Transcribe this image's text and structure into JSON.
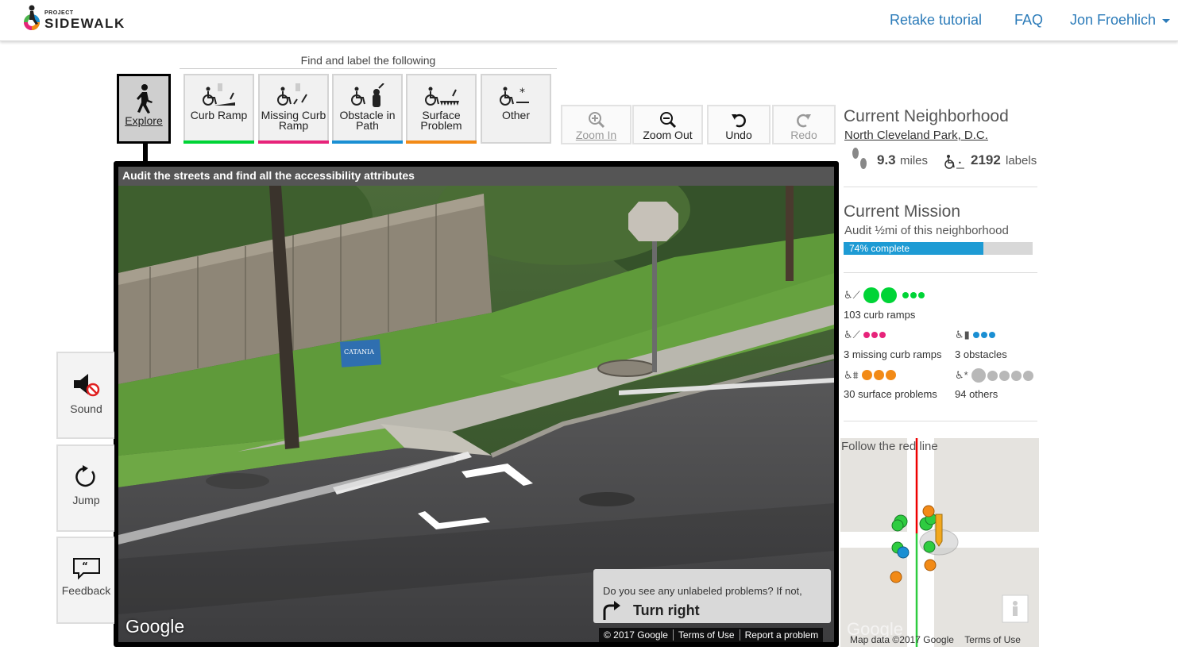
{
  "header": {
    "logo_small": "PROJECT",
    "logo_big": "SIDEWALK",
    "nav": [
      {
        "label": "Retake tutorial"
      },
      {
        "label": "FAQ"
      },
      {
        "label": "Jon Froehlich"
      }
    ]
  },
  "toolbar": {
    "title": "Find and label the following",
    "explore_label": "Explore",
    "modes": [
      {
        "label": "Curb Ramp",
        "color": "#00d436"
      },
      {
        "label": "Missing Curb Ramp",
        "color": "#e7237a"
      },
      {
        "label": "Obstacle in Path",
        "color": "#1a8fd3"
      },
      {
        "label": "Surface Problem",
        "color": "#f28a16"
      },
      {
        "label": "Other",
        "color": "#dddddd"
      }
    ],
    "tools": [
      {
        "label": "Zoom In",
        "icon": "zoom-in-icon",
        "enabled": false
      },
      {
        "label": "Zoom Out",
        "icon": "zoom-out-icon",
        "enabled": true
      },
      {
        "label": "Undo",
        "icon": "undo-icon",
        "enabled": true
      },
      {
        "label": "Redo",
        "icon": "redo-icon",
        "enabled": false
      }
    ]
  },
  "streetview": {
    "header": "Audit the streets and find all the accessibility attributes",
    "sign_text": "CATANIA",
    "google": "Google",
    "hint_question": "Do you see any unlabeled problems? If not,",
    "hint_action": "Turn right",
    "footer": [
      "© 2017 Google",
      "Terms of Use",
      "Report a problem"
    ]
  },
  "side_buttons": [
    {
      "label": "Sound",
      "icon": "sound-muted-icon"
    },
    {
      "label": "Jump",
      "icon": "jump-icon"
    },
    {
      "label": "Feedback",
      "icon": "feedback-icon"
    }
  ],
  "neighborhood": {
    "heading": "Current Neighborhood",
    "name": "North Cleveland Park, D.C.",
    "miles_value": "9.3",
    "miles_unit": "miles",
    "labels_value": "2192",
    "labels_unit": "labels"
  },
  "mission": {
    "heading": "Current Mission",
    "subtitle": "Audit ½mi of this neighborhood",
    "progress_text": "74% complete",
    "progress": 0.74
  },
  "label_counts": [
    {
      "text": "103 curb ramps",
      "color": "#00d436"
    },
    {
      "text": "3 missing curb ramps",
      "color": "#e7237a"
    },
    {
      "text": "3 obstacles",
      "color": "#1a8fd3"
    },
    {
      "text": "30 surface problems",
      "color": "#f28a16"
    },
    {
      "text": "94 others",
      "color": "#b8b8b8"
    }
  ],
  "minimap": {
    "title": "Follow the red line",
    "footer": "Map data ©2017 Google",
    "terms": "Terms of Use",
    "google": "Google"
  }
}
